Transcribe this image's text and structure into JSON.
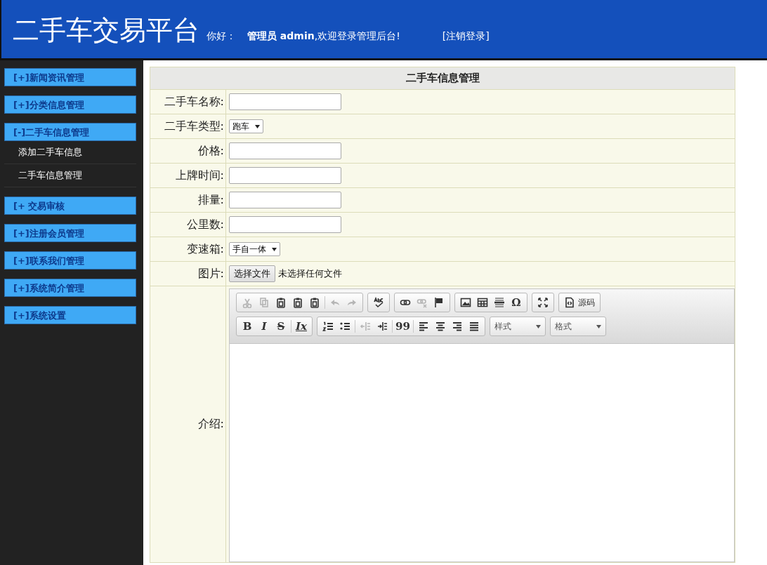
{
  "header": {
    "title": "二手车交易平台",
    "greeting": "你好：",
    "welcome": "**管理员 admin**,欢迎登录管理后台!",
    "logout": "[注销登录]"
  },
  "sidebar": {
    "items": [
      {
        "label": "[+]新闻资讯管理"
      },
      {
        "label": "[+]分类信息管理"
      },
      {
        "label": "[-]二手车信息管理",
        "children": [
          {
            "label": "添加二手车信息"
          },
          {
            "label": "二手车信息管理"
          }
        ]
      },
      {
        "label": "[+ 交易审核"
      },
      {
        "label": "[+]注册会员管理"
      },
      {
        "label": "[+]联系我们管理"
      },
      {
        "label": "[+]系统简介管理"
      },
      {
        "label": "[+]系统设置"
      }
    ]
  },
  "form": {
    "title": "二手车信息管理",
    "fields": [
      {
        "kind": "text",
        "label": "二手车名称:"
      },
      {
        "kind": "select",
        "label": "二手车类型:",
        "value": "跑车"
      },
      {
        "kind": "text",
        "label": "价格:"
      },
      {
        "kind": "text",
        "label": "上牌时间:"
      },
      {
        "kind": "text",
        "label": "排量:"
      },
      {
        "kind": "text",
        "label": "公里数:"
      },
      {
        "kind": "select",
        "label": "变速箱:",
        "value": "手自一体"
      },
      {
        "kind": "file",
        "label": "图片:",
        "button": "选择文件",
        "status": "未选择任何文件"
      },
      {
        "kind": "editor",
        "label": "介绍:",
        "toolbar_rows": [
          {
            "groups": [
              {
                "items": [
                  {
                    "kind": "cut",
                    "disabled": true
                  },
                  {
                    "kind": "copy",
                    "disabled": true
                  },
                  {
                    "kind": "paste",
                    "disabled": false
                  },
                  {
                    "kind": "paste",
                    "disabled": false
                  },
                  {
                    "kind": "paste",
                    "disabled": false
                  },
                  {
                    "kind": "sep"
                  },
                  {
                    "kind": "undo",
                    "disabled": true
                  },
                  {
                    "kind": "redo",
                    "disabled": true
                  }
                ]
              },
              {
                "items": [
                  {
                    "kind": "spell",
                    "disabled": false
                  }
                ]
              },
              {
                "items": [
                  {
                    "kind": "link",
                    "disabled": false
                  },
                  {
                    "kind": "unlink",
                    "disabled": true
                  },
                  {
                    "kind": "flag",
                    "disabled": false
                  }
                ]
              },
              {
                "items": [
                  {
                    "kind": "image",
                    "disabled": false
                  },
                  {
                    "kind": "table",
                    "disabled": false
                  },
                  {
                    "kind": "rule",
                    "disabled": false
                  },
                  {
                    "kind": "glyph",
                    "text": "Ω",
                    "disabled": false
                  }
                ]
              },
              {
                "items": [
                  {
                    "kind": "maximize",
                    "disabled": false
                  }
                ]
              },
              {
                "items": [
                  {
                    "kind": "source",
                    "text": "源码",
                    "disabled": false
                  }
                ]
              }
            ]
          },
          {
            "groups": [
              {
                "items": [
                  {
                    "kind": "glyph",
                    "text": "B",
                    "disabled": false
                  },
                  {
                    "kind": "glyph",
                    "text": "I",
                    "disabled": false
                  },
                  {
                    "kind": "glyph",
                    "text": "S",
                    "disabled": false
                  },
                  {
                    "kind": "sep"
                  },
                  {
                    "kind": "glyph",
                    "text": "Ix",
                    "disabled": false
                  }
                ]
              },
              {
                "items": [
                  {
                    "kind": "olist",
                    "disabled": false
                  },
                  {
                    "kind": "ulist",
                    "disabled": false
                  },
                  {
                    "kind": "sep"
                  },
                  {
                    "kind": "outdent",
                    "disabled": true
                  },
                  {
                    "kind": "indent",
                    "disabled": false
                  },
                  {
                    "kind": "sep"
                  },
                  {
                    "kind": "glyph",
                    "text": "99",
                    "disabled": false
                  },
                  {
                    "kind": "sep"
                  },
                  {
                    "kind": "alignleft",
                    "disabled": false
                  },
                  {
                    "kind": "aligncenter",
                    "disabled": false
                  },
                  {
                    "kind": "alignright",
                    "disabled": false
                  },
                  {
                    "kind": "justify",
                    "disabled": false
                  }
                ]
              },
              {
                "items": [
                  {
                    "kind": "combo",
                    "text": "样式"
                  }
                ]
              },
              {
                "items": [
                  {
                    "kind": "combo",
                    "text": "格式"
                  }
                ]
              }
            ]
          }
        ]
      }
    ]
  }
}
